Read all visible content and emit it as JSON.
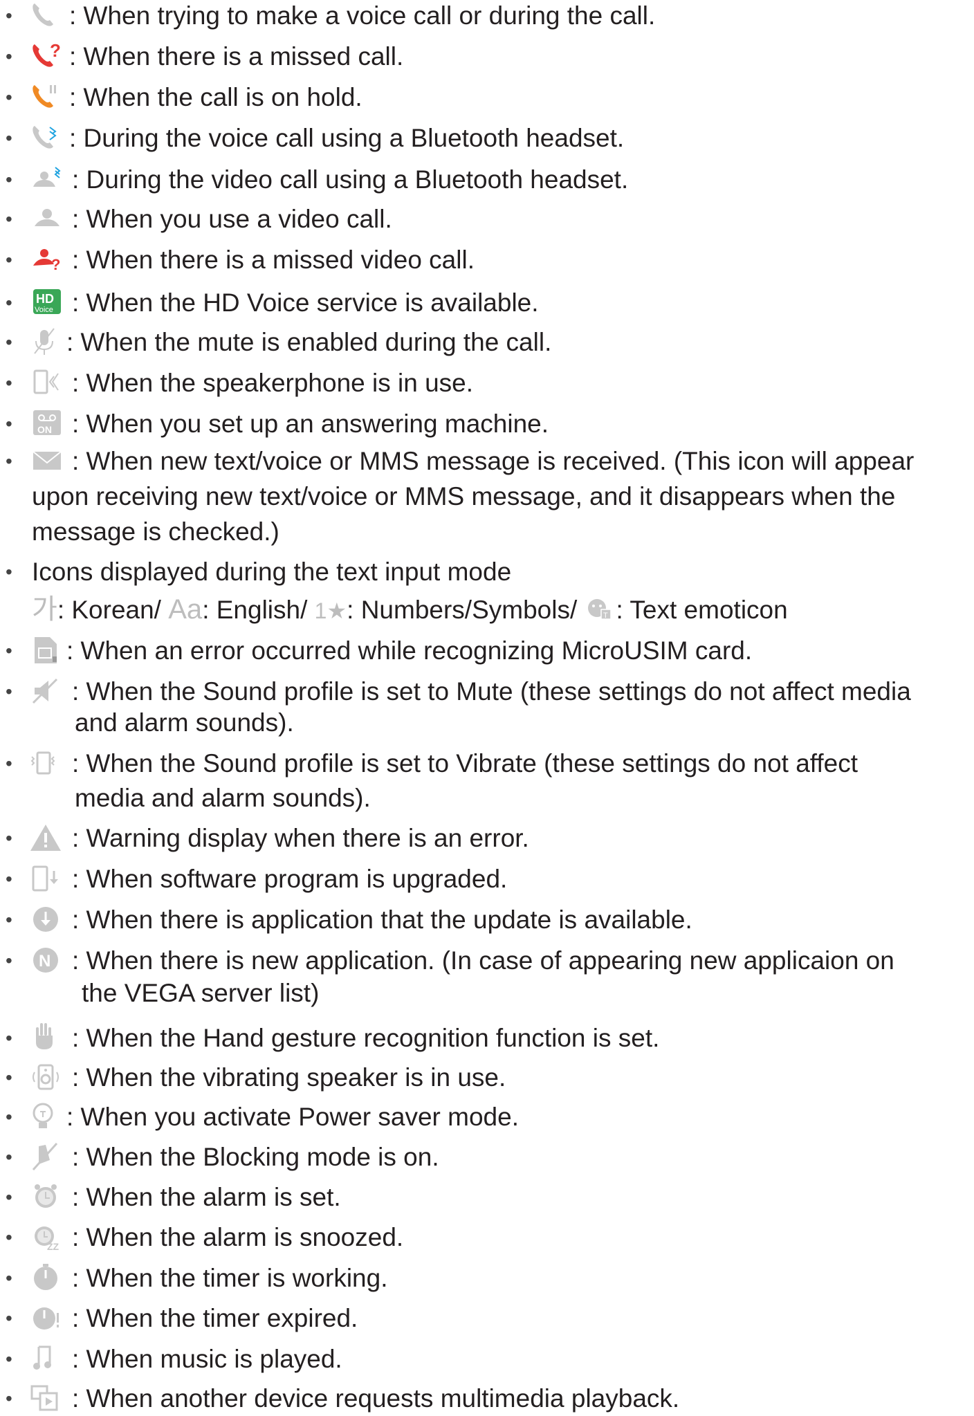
{
  "items": [
    {
      "icon": "phone-call-icon",
      "text": ": When trying to make a voice call or during the call."
    },
    {
      "icon": "missed-call-icon",
      "text": ": When there is a missed call."
    },
    {
      "icon": "call-on-hold-icon",
      "text": ": When the call is on hold."
    },
    {
      "icon": "bluetooth-voice-call-icon",
      "text": ": During the voice call using a Bluetooth headset."
    },
    {
      "icon": "bluetooth-video-call-icon",
      "text": ": During the video call using a Bluetooth headset."
    },
    {
      "icon": "video-call-icon",
      "text": ": When you use a video call."
    },
    {
      "icon": "missed-video-call-icon",
      "text": ": When there is a missed video call."
    },
    {
      "icon": "hd-voice-icon",
      "text": ": When the HD Voice service is available."
    },
    {
      "icon": "mute-mic-icon",
      "text": ": When the mute is enabled during the call."
    },
    {
      "icon": "speakerphone-icon",
      "text": ": When the speakerphone is in use."
    },
    {
      "icon": "answering-machine-icon",
      "text": ": When you set up an answering machine."
    },
    {
      "icon": "message-envelope-icon",
      "text": ": When new text/voice or MMS message is received. (This icon will appear",
      "cont": [
        "upon receiving new text/voice or MMS message, and it disappears when the",
        "message is checked.)"
      ]
    },
    {
      "icon": "",
      "text": "Icons displayed during the text input mode"
    },
    {
      "icon": "usim-error-icon",
      "text": ": When an error occurred while recognizing MicroUSIM card."
    },
    {
      "icon": "sound-mute-icon",
      "text": ": When the Sound profile is set to Mute (these settings do not affect media",
      "cont": [
        "and alarm sounds)."
      ]
    },
    {
      "icon": "vibrate-icon",
      "text": ": When the Sound profile is set to Vibrate (these settings do not affect",
      "cont": [
        "media and alarm sounds)."
      ]
    },
    {
      "icon": "warning-icon",
      "text": ": Warning display when there is an error."
    },
    {
      "icon": "software-upgrade-icon",
      "text": ": When software program is upgraded."
    },
    {
      "icon": "app-update-icon",
      "text": ": When there is application that the update is available."
    },
    {
      "icon": "new-app-icon",
      "text": ": When there is new application. (In case of appearing new applicaion on",
      "cont": [
        "the VEGA server list)"
      ]
    },
    {
      "icon": "hand-gesture-icon",
      "text": ": When the Hand gesture recognition function is set."
    },
    {
      "icon": "vibrating-speaker-icon",
      "text": ": When the vibrating speaker is in use."
    },
    {
      "icon": "power-saver-icon",
      "text": ": When you activate Power saver mode."
    },
    {
      "icon": "blocking-mode-icon",
      "text": ": When the Blocking mode is on."
    },
    {
      "icon": "alarm-icon",
      "text": ": When the alarm is set."
    },
    {
      "icon": "alarm-snooze-icon",
      "text": ": When the alarm is snoozed."
    },
    {
      "icon": "timer-icon",
      "text": ": When the timer is working."
    },
    {
      "icon": "timer-expired-icon",
      "text": ": When the timer expired."
    },
    {
      "icon": "music-icon",
      "text": ": When music is played."
    },
    {
      "icon": "multimedia-playback-icon",
      "text": ": When another device requests multimedia playback."
    }
  ],
  "input_mode": {
    "korean_glyph": "가",
    "korean_label": ": Korean/",
    "english_glyph": "Aa",
    "english_label": ": English/",
    "numbers_glyph": "1★",
    "numbers_label": ": Numbers/Symbols/",
    "emoticon_label": ": Text emoticon"
  },
  "colors": {
    "text": "#231f20",
    "icon_gray": "#c8c8c8",
    "missed_red": "#e53935",
    "hold_orange": "#f08a24",
    "bluetooth_blue": "#1fa3e0",
    "hd_green": "#3aa757"
  }
}
